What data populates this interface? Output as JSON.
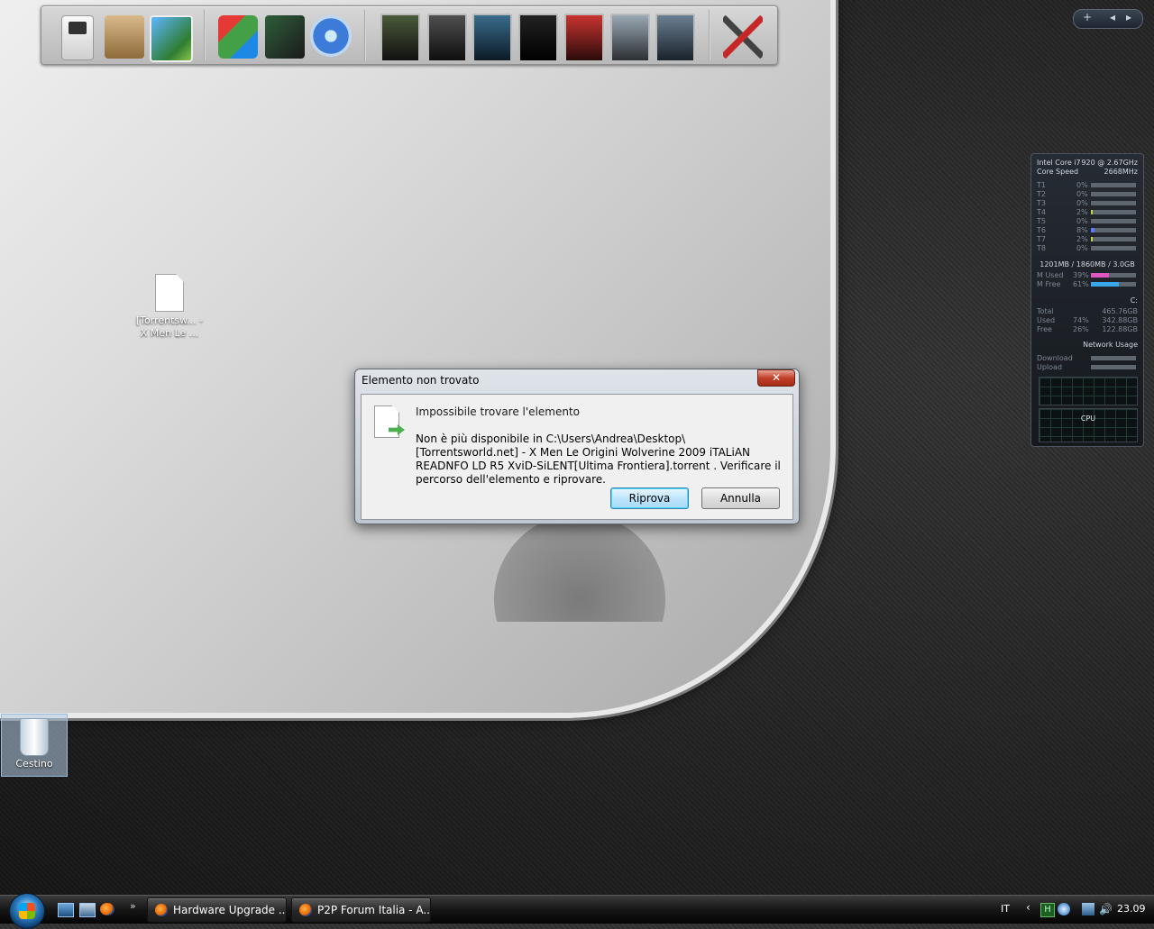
{
  "dock": {
    "items": [
      {
        "name": "iPod"
      },
      {
        "name": "Boxes"
      },
      {
        "name": "Photo Gallery"
      },
      {
        "name": "Cube App"
      },
      {
        "name": "CPU-Z"
      },
      {
        "name": "iTunes"
      },
      {
        "name": "Game 1"
      },
      {
        "name": "Game 2"
      },
      {
        "name": "Game 3"
      },
      {
        "name": "GRID"
      },
      {
        "name": "Mirror's Edge"
      },
      {
        "name": "Game 6"
      },
      {
        "name": "Game 7"
      },
      {
        "name": "Tools"
      }
    ]
  },
  "sidebar_controls": {
    "add": "+",
    "prev": "◂",
    "next": "▸"
  },
  "gadget": {
    "cpu_name": "Intel Core i7",
    "cpu_model": "920 @ 2.67GHz",
    "core_speed_label": "Core Speed",
    "core_speed": "2668MHz",
    "threads": [
      {
        "label": "T1",
        "value": "0%",
        "fill": 0.0
      },
      {
        "label": "T2",
        "value": "0%",
        "fill": 0.0
      },
      {
        "label": "T3",
        "value": "0%",
        "fill": 0.0
      },
      {
        "label": "T4",
        "value": "2%",
        "fill": 0.02
      },
      {
        "label": "T5",
        "value": "0%",
        "fill": 0.0
      },
      {
        "label": "T6",
        "value": "8%",
        "fill": 0.08
      },
      {
        "label": "T7",
        "value": "2%",
        "fill": 0.02
      },
      {
        "label": "T8",
        "value": "0%",
        "fill": 0.0
      }
    ],
    "memory_summary": "1201MB / 1860MB / 3.0GB",
    "mem_used_label": "M Used",
    "mem_used": "39%",
    "mem_used_fill": 0.39,
    "mem_free_label": "M Free",
    "mem_free": "61%",
    "mem_free_fill": 0.61,
    "drive": "C:",
    "total_label": "Total",
    "total": "465.76GB",
    "used_label": "Used",
    "used_pct": "74%",
    "used": "342.88GB",
    "free_label": "Free",
    "free_pct": "26%",
    "free": "122.88GB",
    "network_title": "Network Usage",
    "download_label": "Download",
    "upload_label": "Upload",
    "cpu_graph_label": "CPU"
  },
  "desktop": {
    "torrent_icon_label": "[Torrentsw... - X Men Le ...",
    "recycle_bin_label": "Cestino"
  },
  "dialog": {
    "title": "Elemento non trovato",
    "close": "✕",
    "heading": "Impossibile trovare l'elemento",
    "message": "Non è più disponibile in C:\\Users\\Andrea\\Desktop\\[Torrentsworld.net] - X Men Le Origini Wolverine 2009 iTALiAN READNFO LD R5 XviD-SiLENT[Ultima Frontiera].torrent . Verificare il percorso dell'elemento e riprovare.",
    "retry_label": "Riprova",
    "cancel_label": "Annulla"
  },
  "taskbar": {
    "more": "»",
    "tasks": [
      {
        "label": "Hardware Upgrade ..."
      },
      {
        "label": "P2P Forum Italia - A..."
      }
    ],
    "lang": "IT",
    "chevron": "‹",
    "tray_h": "H",
    "volume": "🔊",
    "clock": "23.09"
  }
}
